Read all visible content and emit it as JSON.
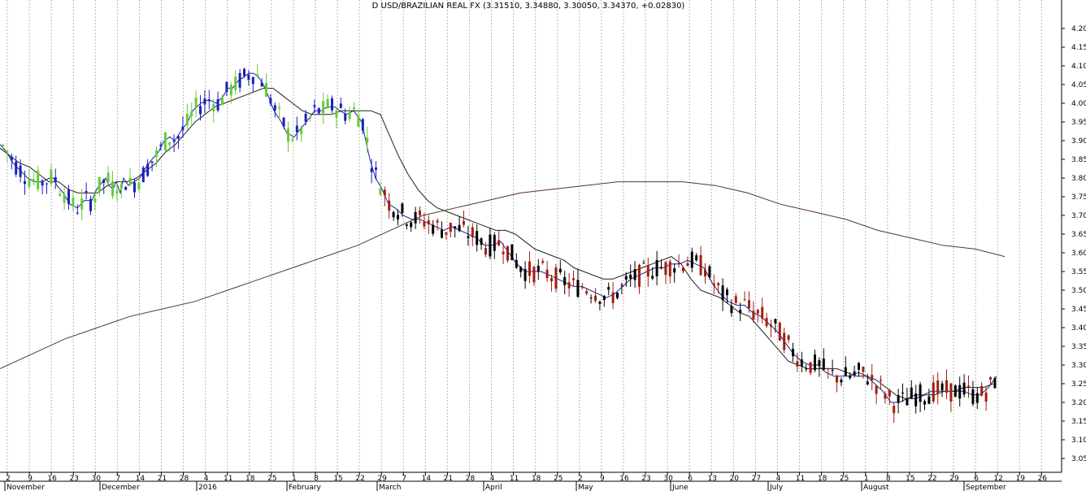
{
  "chart_data": {
    "type": "candlestick",
    "title": "D USD/BRAZILIAN REAL FX (3.31510, 3.34880, 3.30050, 3.34370, +0.02830)",
    "ylim": [
      3.0,
      4.25
    ],
    "y_ticks": [
      3.05,
      3.1,
      3.15,
      3.2,
      3.25,
      3.3,
      3.35,
      3.4,
      3.45,
      3.5,
      3.55,
      3.6,
      3.65,
      3.7,
      3.75,
      3.8,
      3.85,
      3.9,
      3.95,
      4.0,
      4.05,
      4.1,
      4.15,
      4.2
    ],
    "x_day_ticks": [
      "2",
      "9",
      "16",
      "23",
      "30",
      "7",
      "14",
      "21",
      "28",
      "4",
      "11",
      "18",
      "25",
      "1",
      "8",
      "15",
      "22",
      "29",
      "7",
      "14",
      "21",
      "28",
      "4",
      "11",
      "18",
      "25",
      "2",
      "9",
      "16",
      "23",
      "30",
      "6",
      "13",
      "20",
      "27",
      "4",
      "11",
      "18",
      "25",
      "1",
      "8",
      "15",
      "22",
      "29",
      "6",
      "12",
      "19",
      "26"
    ],
    "x_month_labels": [
      "November",
      "December",
      "2016",
      "February",
      "March",
      "April",
      "May",
      "June",
      "July",
      "August",
      "September"
    ],
    "grid": true,
    "colors": {
      "bull_up": "#66cc33",
      "bear_up": "#1e1ebe",
      "bull_down": "#000000",
      "bear_down": "#a02010",
      "ma_fast": "#2020a0",
      "ma_slow": "#202020",
      "ma_long": "#5a3522",
      "grid": "#b8b8b8"
    },
    "moving_averages": [
      {
        "key": "fast",
        "x": [
          0,
          8,
          16,
          25,
          34,
          43,
          52,
          61,
          66,
          70,
          78,
          86,
          95,
          104,
          113,
          119,
          126,
          130,
          134,
          139,
          143,
          148,
          152,
          158,
          165,
          172,
          180,
          187,
          195,
          202,
          209,
          215,
          218,
          224,
          231,
          237,
          247,
          257,
          266,
          275,
          280,
          286,
          293,
          300,
          306,
          312,
          318,
          324,
          330,
          337,
          346,
          353,
          362,
          369,
          377,
          387,
          396,
          402,
          412,
          418,
          426,
          435,
          445,
          455,
          462,
          470,
          478,
          486,
          496,
          506,
          516,
          526,
          536,
          546,
          556,
          566,
          576,
          586,
          596,
          606,
          616,
          626,
          636,
          646,
          656,
          666,
          676,
          686,
          696,
          706,
          716,
          726,
          736,
          746,
          756,
          766,
          776,
          786,
          796,
          806,
          816,
          826,
          836,
          846,
          856,
          866,
          876,
          886,
          896,
          906,
          916,
          926,
          936,
          946,
          956,
          966,
          976,
          986,
          996,
          1006,
          1016,
          1026,
          1036,
          1046,
          1056,
          1066,
          1076,
          1086,
          1096,
          1106,
          1116,
          1126,
          1136,
          1146,
          1156,
          1166,
          1176,
          1186,
          1196,
          1206,
          1216,
          1226,
          1234
        ],
        "y": [
          3.89,
          3.87,
          3.84,
          3.82,
          3.8,
          3.79,
          3.79,
          3.8,
          3.8,
          3.78,
          3.76,
          3.73,
          3.72,
          3.74,
          3.74,
          3.77,
          3.79,
          3.8,
          3.78,
          3.77,
          3.79,
          3.76,
          3.8,
          3.78,
          3.79,
          3.8,
          3.83,
          3.85,
          3.87,
          3.9,
          3.91,
          3.9,
          3.91,
          3.93,
          3.95,
          3.98,
          4.0,
          4.01,
          4.0,
          4.02,
          4.04,
          4.04,
          4.06,
          4.07,
          4.08,
          4.08,
          4.07,
          4.05,
          4.02,
          3.98,
          3.95,
          3.92,
          3.91,
          3.93,
          3.95,
          3.98,
          3.98,
          3.99,
          3.99,
          3.98,
          3.97,
          3.98,
          3.95,
          3.85,
          3.8,
          3.77,
          3.73,
          3.72,
          3.7,
          3.69,
          3.69,
          3.68,
          3.67,
          3.66,
          3.67,
          3.66,
          3.65,
          3.64,
          3.62,
          3.62,
          3.63,
          3.6,
          3.57,
          3.55,
          3.55,
          3.55,
          3.54,
          3.53,
          3.52,
          3.51,
          3.51,
          3.5,
          3.49,
          3.48,
          3.49,
          3.51,
          3.53,
          3.54,
          3.55,
          3.56,
          3.56,
          3.57,
          3.57,
          3.58,
          3.57,
          3.56,
          3.52,
          3.49,
          3.47,
          3.46,
          3.46,
          3.44,
          3.43,
          3.41,
          3.39,
          3.36,
          3.33,
          3.31,
          3.3,
          3.3,
          3.28,
          3.27,
          3.27,
          3.27,
          3.28,
          3.27,
          3.25,
          3.23,
          3.2,
          3.2,
          3.21,
          3.22,
          3.22,
          3.23,
          3.23,
          3.23,
          3.23,
          3.23,
          3.22,
          3.22,
          3.24,
          3.27
        ]
      },
      {
        "key": "slow",
        "x": [
          0,
          12,
          24,
          36,
          48,
          60,
          72,
          84,
          96,
          108,
          120,
          132,
          144,
          156,
          168,
          180,
          192,
          204,
          216,
          228,
          240,
          252,
          264,
          276,
          288,
          300,
          312,
          324,
          336,
          348,
          360,
          372,
          384,
          396,
          408,
          420,
          432,
          444,
          456,
          468,
          478,
          490,
          502,
          514,
          526,
          538,
          550,
          562,
          574,
          586,
          598,
          610,
          622,
          634,
          646,
          658,
          670,
          682,
          694,
          706,
          718,
          730,
          742,
          754,
          766,
          778,
          790,
          802,
          814,
          826,
          838,
          850,
          862,
          874,
          886,
          898,
          910,
          922,
          934,
          946,
          958,
          970,
          982,
          994,
          1006,
          1018,
          1030,
          1042,
          1054,
          1066,
          1078,
          1090,
          1102,
          1114,
          1126,
          1138,
          1150,
          1162,
          1174,
          1186,
          1198,
          1210,
          1222,
          1234
        ],
        "y": [
          3.88,
          3.86,
          3.84,
          3.83,
          3.81,
          3.79,
          3.79,
          3.77,
          3.76,
          3.76,
          3.76,
          3.78,
          3.79,
          3.79,
          3.8,
          3.82,
          3.84,
          3.87,
          3.89,
          3.92,
          3.95,
          3.97,
          3.99,
          4.0,
          4.01,
          4.02,
          4.03,
          4.04,
          4.04,
          4.02,
          4.0,
          3.98,
          3.97,
          3.97,
          3.97,
          3.98,
          3.98,
          3.98,
          3.98,
          3.97,
          3.92,
          3.86,
          3.81,
          3.77,
          3.74,
          3.72,
          3.71,
          3.7,
          3.69,
          3.68,
          3.67,
          3.66,
          3.66,
          3.65,
          3.63,
          3.61,
          3.6,
          3.59,
          3.58,
          3.56,
          3.55,
          3.54,
          3.53,
          3.53,
          3.54,
          3.55,
          3.56,
          3.57,
          3.58,
          3.59,
          3.57,
          3.53,
          3.5,
          3.49,
          3.48,
          3.46,
          3.44,
          3.43,
          3.4,
          3.37,
          3.34,
          3.31,
          3.3,
          3.29,
          3.29,
          3.29,
          3.29,
          3.28,
          3.27,
          3.27,
          3.26,
          3.24,
          3.22,
          3.21,
          3.21,
          3.22,
          3.22,
          3.23,
          3.23,
          3.24,
          3.24,
          3.24,
          3.25
        ]
      },
      {
        "key": "long",
        "x": [
          0,
          40,
          80,
          120,
          160,
          200,
          240,
          280,
          320,
          360,
          400,
          440,
          480,
          520,
          560,
          600,
          640,
          680,
          720,
          760,
          800,
          840,
          880,
          920,
          960,
          1000,
          1040,
          1080,
          1120,
          1160,
          1200,
          1236
        ],
        "y": [
          3.29,
          3.33,
          3.37,
          3.4,
          3.43,
          3.45,
          3.47,
          3.5,
          3.53,
          3.56,
          3.59,
          3.62,
          3.66,
          3.7,
          3.72,
          3.74,
          3.76,
          3.77,
          3.78,
          3.79,
          3.79,
          3.79,
          3.78,
          3.76,
          3.73,
          3.71,
          3.69,
          3.66,
          3.64,
          3.62,
          3.61,
          3.59
        ]
      }
    ]
  }
}
